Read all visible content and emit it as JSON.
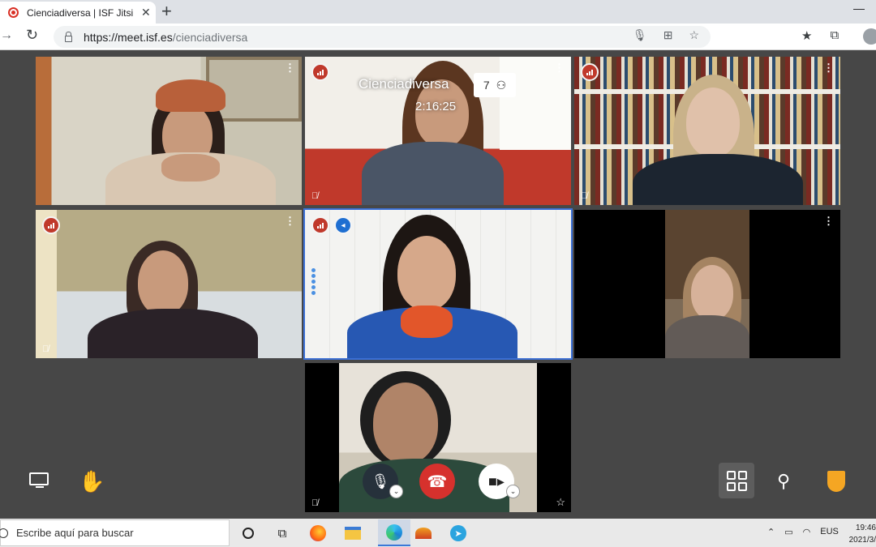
{
  "browser": {
    "tab_title": "Cienciadiversa | ISF Jitsi Meet",
    "tab_close": "✕",
    "new_tab": "+",
    "minimize": "—",
    "url_host": "https://meet.isf.es",
    "url_path": "/cienciadiversa"
  },
  "meeting": {
    "title": "Cienciadiversa",
    "participant_count": "7",
    "elapsed_time": "2:16:25"
  },
  "participants": [
    {
      "tile": 1,
      "connection": "weak",
      "muted": false
    },
    {
      "tile": 2,
      "connection": "weak",
      "muted": true
    },
    {
      "tile": 3,
      "connection": "weak",
      "muted": true
    },
    {
      "tile": 4,
      "connection": "weak",
      "muted": true
    },
    {
      "tile": 5,
      "connection": "weak",
      "dominant_speaker": true,
      "muted": false
    },
    {
      "tile": 6,
      "connection": "good",
      "muted": false
    },
    {
      "tile": 7,
      "local": true,
      "muted": true
    }
  ],
  "toolbar": {
    "mic_muted": true,
    "camera_on": true
  },
  "taskbar": {
    "search_placeholder": "Escribe aquí para buscar",
    "language": "EUS",
    "time": "19:46",
    "date": "2021/3/"
  },
  "colors": {
    "accent_blue": "#3b6fd4",
    "hangup_red": "#d6312d",
    "signal_red": "#c0392b",
    "shield_orange": "#f5a623"
  }
}
